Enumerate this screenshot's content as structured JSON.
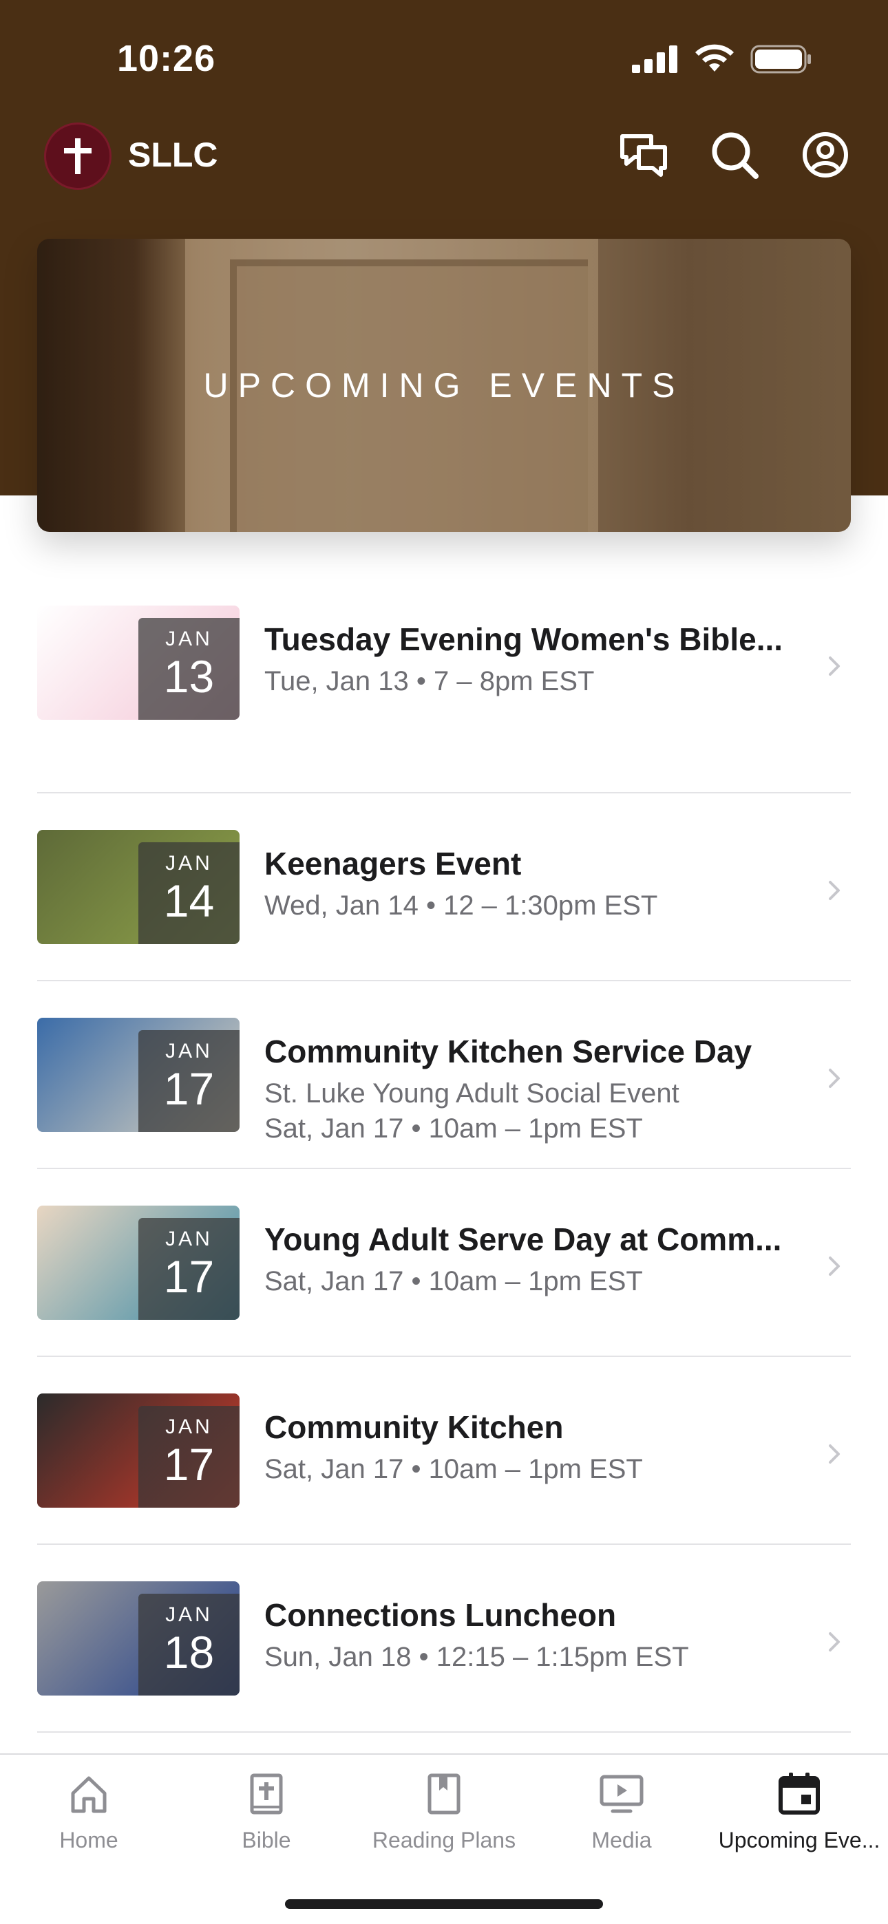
{
  "status": {
    "time": "10:26"
  },
  "app": {
    "name": "SLLC"
  },
  "hero": {
    "title": "UPCOMING EVENTS"
  },
  "events": [
    {
      "month": "JAN",
      "day": "13",
      "title": "Tuesday Evening Women's Bible...",
      "lines": [
        "Tue, Jan 13 • 7 – 8pm EST"
      ],
      "thumb_colors": [
        "#ffffff",
        "#f4c6d6"
      ]
    },
    {
      "month": "JAN",
      "day": "14",
      "title": "Keenagers Event",
      "lines": [
        "Wed, Jan 14 • 12 – 1:30pm EST"
      ],
      "thumb_colors": [
        "#5e6a38",
        "#8fa24a"
      ]
    },
    {
      "month": "JAN",
      "day": "17",
      "title": "Community Kitchen Service Day",
      "lines": [
        "St. Luke Young Adult Social Event",
        "Sat, Jan 17 • 10am – 1pm EST"
      ],
      "thumb_colors": [
        "#3b6ca8",
        "#d9d2c0"
      ]
    },
    {
      "month": "JAN",
      "day": "17",
      "title": "Young Adult Serve Day at Comm...",
      "lines": [
        "Sat, Jan 17 • 10am – 1pm EST"
      ],
      "thumb_colors": [
        "#e8d6c2",
        "#3a8aa6"
      ]
    },
    {
      "month": "JAN",
      "day": "17",
      "title": "Community Kitchen",
      "lines": [
        "Sat, Jan 17 • 10am – 1pm EST"
      ],
      "thumb_colors": [
        "#2b2b2b",
        "#d23a2a"
      ]
    },
    {
      "month": "JAN",
      "day": "18",
      "title": "Connections Luncheon",
      "lines": [
        "Sun, Jan 18 • 12:15 – 1:15pm EST"
      ],
      "thumb_colors": [
        "#9a9a9a",
        "#1f3d8a"
      ]
    }
  ],
  "tabs": [
    {
      "label": "Home",
      "icon": "home-icon",
      "active": false
    },
    {
      "label": "Bible",
      "icon": "bible-icon",
      "active": false
    },
    {
      "label": "Reading Plans",
      "icon": "bookmark-book-icon",
      "active": false
    },
    {
      "label": "Media",
      "icon": "play-screen-icon",
      "active": false
    },
    {
      "label": "Upcoming Eve...",
      "icon": "calendar-icon",
      "active": true
    }
  ],
  "colors": {
    "header": "#4a2f14",
    "logo": "#5e0f1c",
    "chevron": "#c7c7cc",
    "inactive_tab": "#8e8e93"
  }
}
